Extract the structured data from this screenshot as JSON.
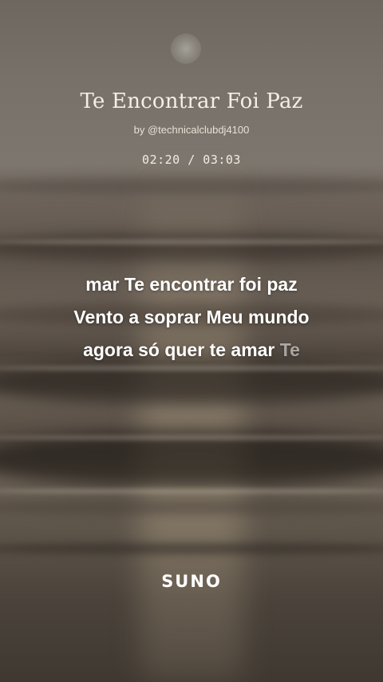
{
  "song": {
    "title": "Te Encontrar Foi Paz",
    "byline": "by @technicalclubdj4100",
    "time_display": "02:20 / 03:03"
  },
  "lyrics": {
    "line1": "mar Te encontrar foi paz",
    "line2": "Vento a soprar Meu mundo",
    "line3_sung": "agora só quer te amar",
    "line3_upcoming": "Te"
  },
  "brand": {
    "logo_text": "SUNO"
  },
  "colors": {
    "text_primary": "#ffffff",
    "text_upcoming": "#ffffff8c",
    "background": "#5e554c"
  }
}
